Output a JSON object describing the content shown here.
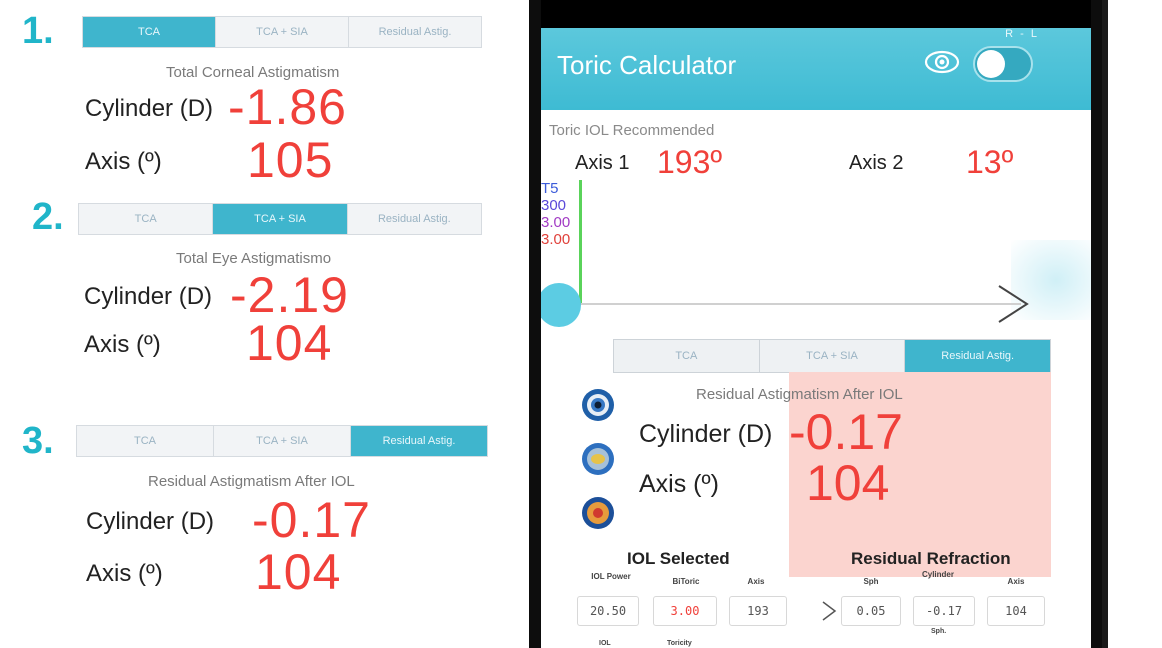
{
  "panels": [
    {
      "number": "1.",
      "tabs": [
        "TCA",
        "TCA + SIA",
        "Residual Astig."
      ],
      "active": 0,
      "subtitle": "Total Corneal Astigmatism",
      "cylinder_label": "Cylinder (D)",
      "cylinder_value": "-1.86",
      "axis_label": "Axis (º)",
      "axis_value": "105"
    },
    {
      "number": "2.",
      "tabs": [
        "TCA",
        "TCA + SIA",
        "Residual Astig."
      ],
      "active": 1,
      "subtitle": "Total Eye Astigmatismo",
      "cylinder_label": "Cylinder (D)",
      "cylinder_value": "-2.19",
      "axis_label": "Axis (º)",
      "axis_value": "104"
    },
    {
      "number": "3.",
      "tabs": [
        "TCA",
        "TCA + SIA",
        "Residual Astig."
      ],
      "active": 2,
      "subtitle": "Residual Astigmatism After IOL",
      "cylinder_label": "Cylinder (D)",
      "cylinder_value": "-0.17",
      "axis_label": "Axis (º)",
      "axis_value": "104"
    }
  ],
  "phone": {
    "app_title": "Toric Calculator",
    "rl_label": "R - L",
    "recommended_title": "Toric IOL Recommended",
    "axis1_label": "Axis 1",
    "axis1_value": "193º",
    "axis2_label": "Axis 2",
    "axis2_value": "13º",
    "toric_labels": [
      "T5",
      "300",
      "3.00",
      "3.00"
    ],
    "tabs": [
      "TCA",
      "TCA + SIA",
      "Residual Astig."
    ],
    "active_tab": 2,
    "residual_subtitle": "Residual Astigmatism After IOL",
    "cylinder_label": "Cylinder (D)",
    "cylinder_value": "-0.17",
    "axis_label": "Axis (º)",
    "axis_value": "104",
    "iol_selected_title": "IOL Selected",
    "residual_refraction_title": "Residual Refraction",
    "iol_headers": [
      "IOL Power",
      "BiToric",
      "Axis"
    ],
    "refraction_headers": [
      "Sph",
      "Cylinder",
      "Axis"
    ],
    "iol_values": [
      "20.50",
      "3.00",
      "193"
    ],
    "refraction_values": [
      "0.05",
      "-0.17",
      "104"
    ],
    "bottom_headers": [
      "IOL",
      "Toricity",
      "Sph."
    ]
  },
  "colors": {
    "accent": "#3fb5cd",
    "value_red": "#f0403a",
    "step_number": "#20b5c9",
    "residual_highlight": "#fbd4cf"
  }
}
